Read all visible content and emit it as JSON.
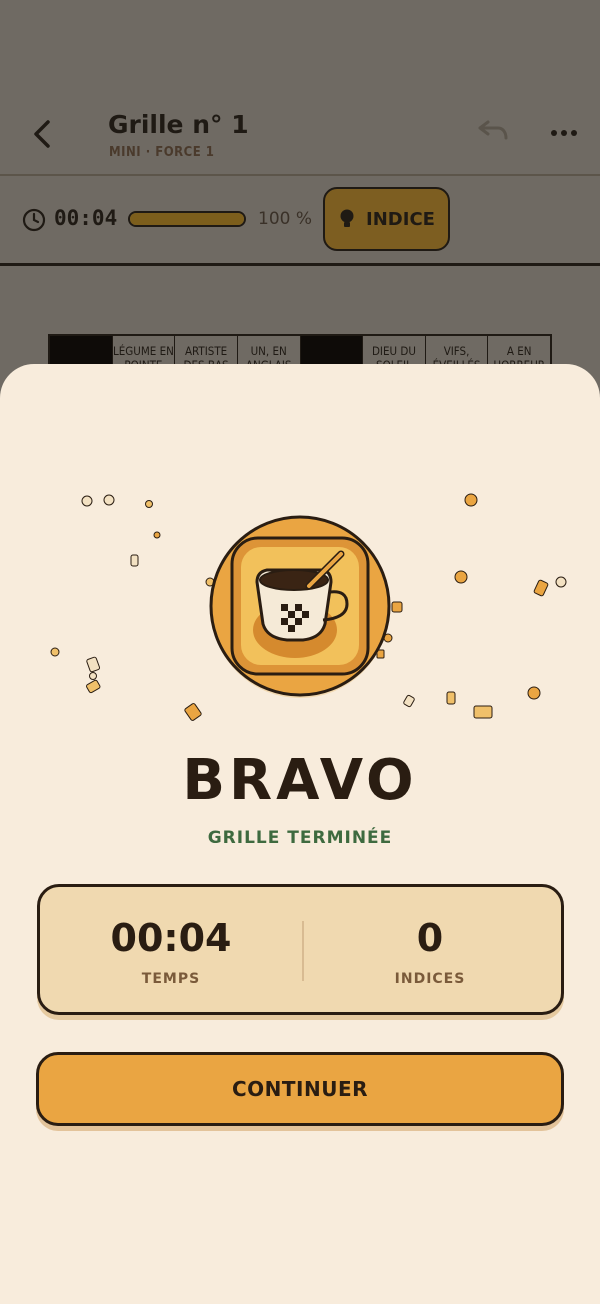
{
  "header": {
    "title": "Grille n° 1",
    "subtitle": "MINI · FORCE 1"
  },
  "toolbar": {
    "timer": "00:04",
    "progress_percent": 100,
    "progress_label": "100 %",
    "hint_label": "INDICE"
  },
  "grid_clues": [
    {
      "text": ""
    },
    {
      "text": "LÉGUME EN POINTE"
    },
    {
      "text": "ARTISTE DES BAS"
    },
    {
      "text": "UN, EN ANGLAIS"
    },
    {
      "text": ""
    },
    {
      "text": "DIEU DU SOLEIL"
    },
    {
      "text": "VIFS, ÉVEILLÉS"
    },
    {
      "text": "A EN HORREUR"
    }
  ],
  "modal": {
    "title": "BRAVO",
    "subtitle": "GRILLE TERMINÉE",
    "stats": {
      "time_value": "00:04",
      "time_label": "TEMPS",
      "hints_value": "0",
      "hints_label": "INDICES"
    },
    "continue_label": "CONTINUER"
  },
  "colors": {
    "sheet_bg": "#f8ecdc",
    "accent": "#eaa542",
    "success_text": "#3e6a3f",
    "dark": "#2a1d12"
  }
}
